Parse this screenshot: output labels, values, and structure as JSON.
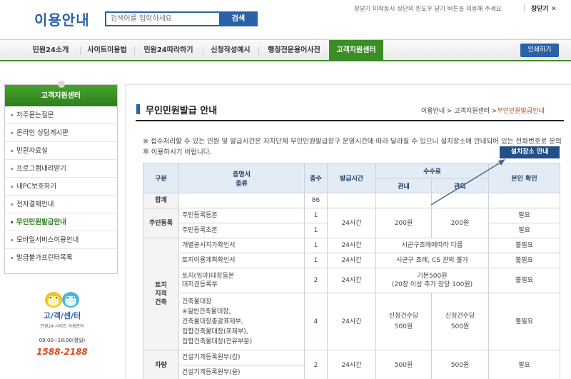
{
  "header": {
    "logo": "이용안내",
    "search_placeholder": "검색어를 입력하세요",
    "search_button": "검색",
    "close_note": "창닫기 미작동시 상단의 윈도우 닫기 버튼을 이용해 주세요",
    "close_label": "창닫기 ✕"
  },
  "nav": {
    "items": [
      "민원24소개",
      "사이트이용법",
      "민원24따라하기",
      "신청작성예시",
      "행정전문용어사전",
      "고객지원센터"
    ],
    "print_label": "인쇄하기"
  },
  "sidebar": {
    "title": "고객지원센터",
    "items": [
      "자주묻는질문",
      "온라인 상담게시판",
      "민원자료실",
      "프로그램내려받기",
      "내PC보호하기",
      "전자결제안내",
      "무인민원발급안내",
      "모바일서비스이용안내",
      "발급불가프린터목록"
    ]
  },
  "promo": {
    "title": "고/객/센/터",
    "sub": "민원24 사이트 이용문의",
    "hours": "09:00~18:00(평일)",
    "phone": "1588-2188"
  },
  "content": {
    "title": "무인민원발급 안내",
    "breadcrumb": [
      "이용안내",
      "고객지원센터",
      "무인민원발급안내"
    ],
    "notice": "※ 접수처리할 수 있는 민원 및 발급시간은 자치단체 무인민원발급창구 운영시간에 따라 달라질 수 있으니 설치장소에 안내되어 있는 전화번호로 문의 후 이용하시기 바랍니다.",
    "install_button": "설치장소 안내"
  },
  "table": {
    "headers": {
      "category": "구분",
      "doc_line1": "증명서",
      "doc_line2": "종류",
      "count": "종수",
      "time": "발급시간",
      "fee": "수수료",
      "fee_in": "관내",
      "fee_out": "관외",
      "id_check": "본인 확인"
    },
    "total": {
      "label": "합계",
      "count": "86"
    },
    "resident": {
      "label": "주민등록",
      "rows": [
        {
          "doc": "주민등록등본",
          "count": "1",
          "id": "필요"
        },
        {
          "doc": "주민등록초본",
          "count": "1",
          "id": "필요"
        }
      ],
      "time": "24시간",
      "fee_in": "200원",
      "fee_out": "200원"
    },
    "land": {
      "label_1": "토지",
      "label_2": "지적",
      "label_3": "건축",
      "rows": [
        {
          "doc": "개별공시지가확인서",
          "count": "1",
          "time": "24시간",
          "fee": "시군구조례에따라 다름",
          "id": "불필요"
        },
        {
          "doc": "토지이용계획확인서",
          "count": "1",
          "time": "24시간",
          "fee": "시군구 조례, CS 관외 불가",
          "id": "불필요"
        },
        {
          "doc_1": "토지(임야)대장등본",
          "doc_2": "대지권등록부",
          "count": "2",
          "time": "24시간",
          "fee_1": "기본500원",
          "fee_2": "(20장 이상 추가 장당 100원)",
          "id": "불필요"
        },
        {
          "doc_1": "건축물대장",
          "doc_2": "※일반건축물대장,",
          "doc_3": "건축물대장총괄표제부,",
          "doc_4": "집합건축물대장(표제부),",
          "doc_5": "집합건축물대장(전유부분)",
          "count": "4",
          "time": "24시간",
          "fee_in_1": "신청건수당",
          "fee_in_2": "500원",
          "fee_out_1": "신청건수당",
          "fee_out_2": "500원",
          "id": "불필요"
        }
      ]
    },
    "machine": {
      "label": "차량",
      "rows": [
        {
          "doc": "건설기계등록원부(갑)"
        },
        {
          "doc": "건설기계등록원부(을)"
        }
      ],
      "count": "2",
      "time": "24시간",
      "fee_in": "500원",
      "fee_out": "500원",
      "id": "필요"
    }
  },
  "colors": {
    "brand_blue": "#2a62a8",
    "nav_green": "#3a8e25",
    "breadcrumb_current": "#b14a1e",
    "phone_orange": "#d94a1c"
  }
}
